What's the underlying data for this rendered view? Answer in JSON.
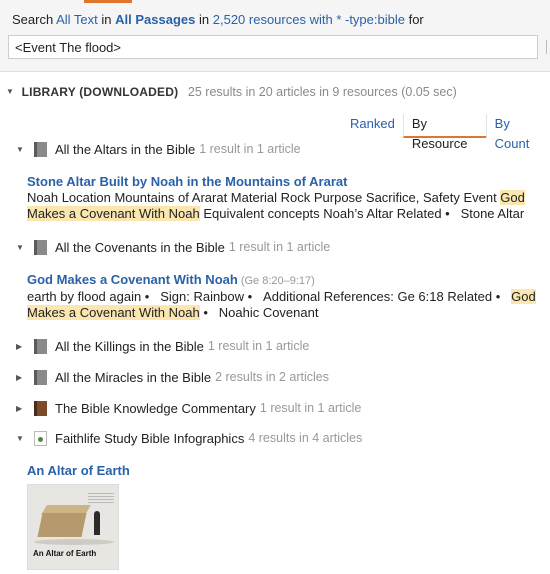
{
  "search": {
    "prefix": "Search",
    "scope_text": "All Text",
    "in1": "in",
    "scope_passages": "All Passages",
    "in2": "in",
    "resources_link": "2,520 resources with * -type:bible",
    "suffix": "for",
    "query": "<Event The flood>"
  },
  "library": {
    "title": "LIBRARY (DOWNLOADED)",
    "stats": "25 results in 20 articles in 9 resources (0.05 sec)"
  },
  "sort_tabs": [
    "Ranked",
    "By Resource",
    "By Count"
  ],
  "resources": [
    {
      "title": "All the Altars in the Bible",
      "count": "1 result in 1 article",
      "expanded": true
    },
    {
      "title": "All the Covenants in the Bible",
      "count": "1 result in 1 article",
      "expanded": true
    },
    {
      "title": "All the Killings in the Bible",
      "count": "1 result in 1 article",
      "expanded": false
    },
    {
      "title": "All the Miracles in the Bible",
      "count": "2 results in 2 articles",
      "expanded": false
    },
    {
      "title": "The Bible Knowledge Commentary",
      "count": "1 result in 1 article",
      "expanded": false
    },
    {
      "title": "Faithlife Study Bible Infographics",
      "count": "4 results in 4 articles",
      "expanded": true
    }
  ],
  "articles": {
    "altar": {
      "title": "Stone Altar Built by Noah in the Mountains of Ararat",
      "text1": "Noah Location Mountains of Ararat Material Rock Purpose Sacrifice, Safety Event ",
      "highlight": "God Makes a Covenant With Noah",
      "text2": " Equivalent concepts Noah’s Altar Related •",
      "text3": "Stone Altar"
    },
    "covenant": {
      "title": "God Makes a Covenant With Noah",
      "ref": "(Ge 8:20–9:17)",
      "text1": "earth by flood again •",
      "text2": "Sign: Rainbow •",
      "text3": "Additional References: Ge 6:18 Related •",
      "highlight": "God Makes a Covenant With Noah",
      "text4": "•",
      "text5": "Noahic Covenant"
    },
    "infographic": {
      "title": "An Altar of Earth",
      "thumb_caption": "An Altar of Earth"
    }
  },
  "icons": {
    "expanded_caret": "triangle-down",
    "collapsed_caret": "triangle-right",
    "book": "resource-cover"
  },
  "colors": {
    "link": "#2a62a8",
    "accent": "#e0762e",
    "highlight": "#fbe6b0",
    "muted": "#999999"
  }
}
